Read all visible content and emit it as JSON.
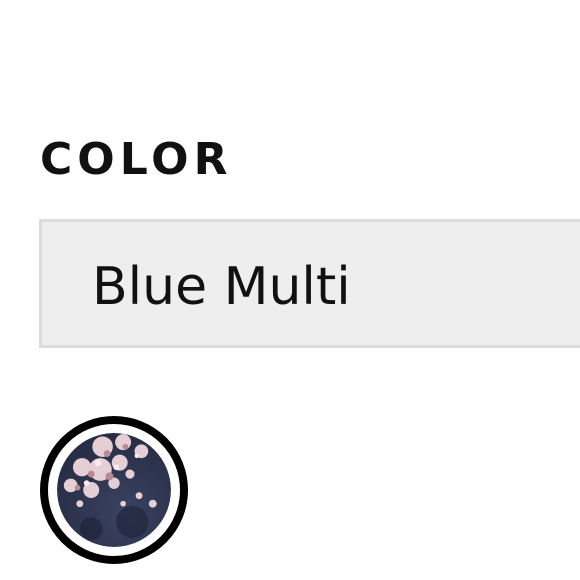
{
  "color_picker": {
    "label": "COLOR",
    "selected_value": "Blue Multi",
    "swatches": [
      {
        "name": "Blue Multi",
        "selected": true,
        "base_color": "#2e3550",
        "accent_color": "#e8cdd2"
      }
    ]
  }
}
